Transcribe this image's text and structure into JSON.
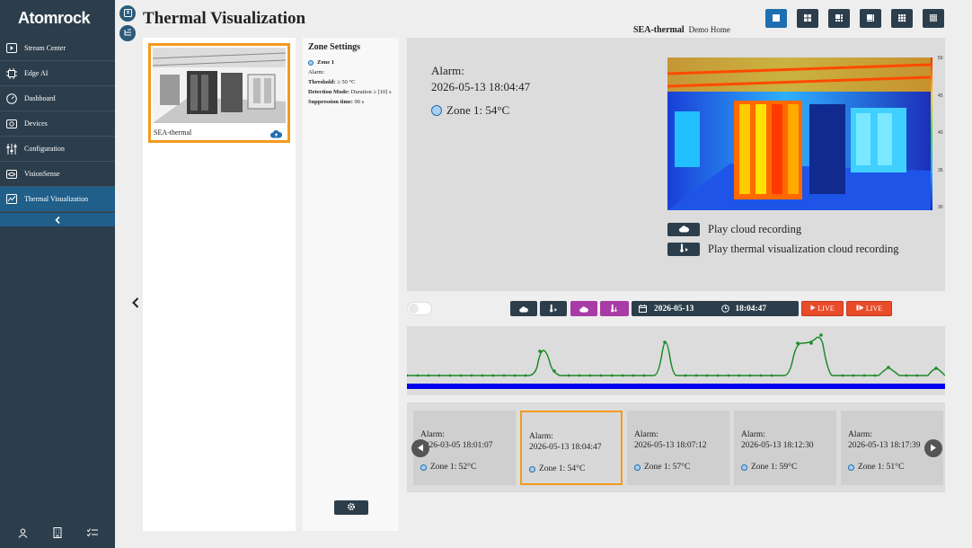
{
  "brand": {
    "logo": "Atomrock"
  },
  "sidebar": {
    "items": [
      {
        "label": "Stream Center",
        "icon": "play-icon"
      },
      {
        "label": "Edge AI",
        "icon": "chip-icon"
      },
      {
        "label": "Dashboard",
        "icon": "gauge-icon"
      },
      {
        "label": "Devices",
        "icon": "camera-icon"
      },
      {
        "label": "Configuration",
        "icon": "sliders-icon"
      },
      {
        "label": "VisionSense",
        "icon": "eye-icon"
      },
      {
        "label": "Thermal Visualization",
        "icon": "thermal-icon",
        "active": true
      }
    ],
    "collapse_icon": "chevron-left-icon",
    "bottom_icons": [
      "user-icon",
      "building-icon",
      "checklist-icon"
    ]
  },
  "header": {
    "title": "Thermal Visualization",
    "device": "SEA-thermal",
    "site": "Demo Home"
  },
  "device_card": {
    "name": "SEA-thermal"
  },
  "zone_settings": {
    "title": "Zone Settings",
    "zone_name": "Zone 1",
    "alarm_label": "Alarm:",
    "threshold_label": "Threshold:",
    "threshold_value": "≥ 50 °C",
    "detection_label": "Detection Mode:",
    "detection_value": "Duration ≥ [10] s",
    "suppression_label": "Suppression time:",
    "suppression_value": "90 s"
  },
  "viewer": {
    "alarm_label": "Alarm:",
    "alarm_time": "2026-05-13 18:04:47",
    "zone_text": "Zone 1: 54°C",
    "scale_ticks": [
      "50",
      "45",
      "40",
      "35",
      "30"
    ],
    "play_cloud": "Play cloud recording",
    "play_thermal": "Play thermal visualization cloud recording"
  },
  "controls": {
    "date": "2026-05-13",
    "time": "18:04:47",
    "live_label": "LIVE",
    "live2_label": "LIVE"
  },
  "alarms": [
    {
      "label": "Alarm:",
      "time": "2026-03-05 18:01:07",
      "zone": "Zone 1: 52°C"
    },
    {
      "label": "Alarm:",
      "time": "2026-05-13 18:04:47",
      "zone": "Zone 1: 54°C",
      "selected": true
    },
    {
      "label": "Alarm:",
      "time": "2026-05-13 18:07:12",
      "zone": "Zone 1: 57°C"
    },
    {
      "label": "Alarm:",
      "time": "2026-05-13 18:12:30",
      "zone": "Zone 1: 59°C"
    },
    {
      "label": "Alarm:",
      "time": "2026-05-13 18:17:39",
      "zone": "Zone 1: 51°C"
    }
  ],
  "colors": {
    "sidebar": "#2c3e4c",
    "active": "#1f5f8a",
    "accent": "#f39a1e",
    "line": "#1c8a2a",
    "bar": "#0000ee"
  }
}
